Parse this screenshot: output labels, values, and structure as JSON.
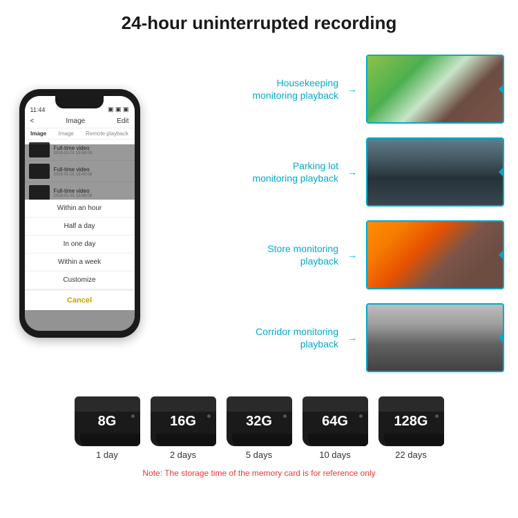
{
  "header": {
    "title": "24-hour uninterrupted recording"
  },
  "phone": {
    "status_time": "11:44",
    "nav_back": "<",
    "nav_title": "Image",
    "nav_edit": "Edit",
    "tabs": [
      "Image",
      "Image",
      "Remote playback"
    ],
    "list_items": [
      {
        "title": "Full-time video",
        "time": "2019-01-01 15:58:08"
      },
      {
        "title": "Full-time video",
        "time": "2019-01-01 13:45:08"
      },
      {
        "title": "Full-time video",
        "time": "2019-01-01 13:48:08"
      }
    ],
    "dropdown_items": [
      "Within an hour",
      "Half a day",
      "In one day",
      "Within a week",
      "Customize"
    ],
    "cancel_label": "Cancel"
  },
  "monitoring": [
    {
      "label": "Housekeeping\nmonitoring playback",
      "photo_type": "housekeeping"
    },
    {
      "label": "Parking lot\nmonitoring playback",
      "photo_type": "parking"
    },
    {
      "label": "Store monitoring\nplayback",
      "photo_type": "store"
    },
    {
      "label": "Corridor monitoring\nplayback",
      "photo_type": "corridor"
    }
  ],
  "sd_cards": [
    {
      "size": "8G",
      "days": "1 day"
    },
    {
      "size": "16G",
      "days": "2 days"
    },
    {
      "size": "32G",
      "days": "5 days"
    },
    {
      "size": "64G",
      "days": "10 days"
    },
    {
      "size": "128G",
      "days": "22 days"
    }
  ],
  "note": "Note: The storage time of the memory card is for reference only"
}
